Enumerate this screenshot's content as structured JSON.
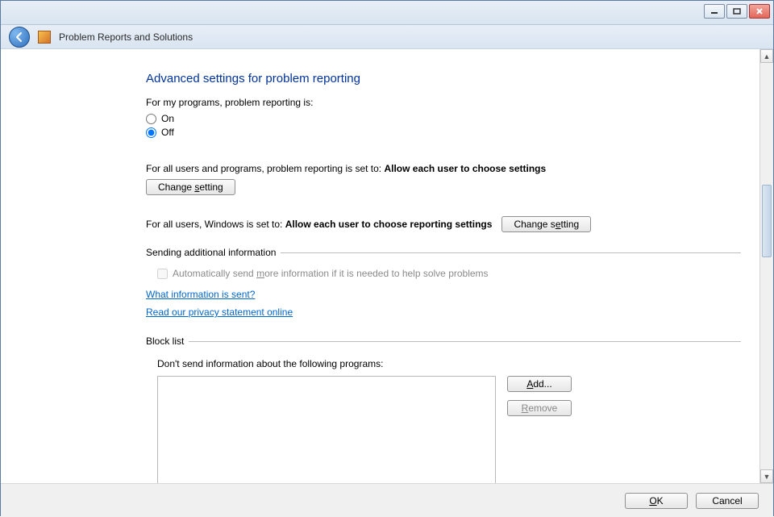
{
  "window_title": "Problem Reports and Solutions",
  "heading": "Advanced settings for problem reporting",
  "my_programs_label": "For my programs, problem reporting is:",
  "radio_on_label": "On",
  "radio_off_label": "Off",
  "radio_selected": "Off",
  "all_users_programs_prefix": "For all users and programs, problem reporting is set to: ",
  "all_users_programs_value": "Allow each user to choose settings",
  "change_setting_label": "Change setting",
  "all_users_windows_prefix": "For all users, Windows is set to: ",
  "all_users_windows_value": "Allow each user to choose reporting settings",
  "group_sending_title": "Sending additional information",
  "cb_auto_send_label": "Automatically send more information if it is needed to help solve problems",
  "cb_auto_send_checked": false,
  "cb_auto_send_enabled": false,
  "link_what_info": "What information is sent?",
  "link_privacy": "Read our privacy statement online",
  "group_block_title": "Block list",
  "block_list_label": "Don't send information about the following programs:",
  "add_button": "Add...",
  "remove_button": "Remove",
  "remove_enabled": false,
  "ok_label": "OK",
  "cancel_label": "Cancel"
}
